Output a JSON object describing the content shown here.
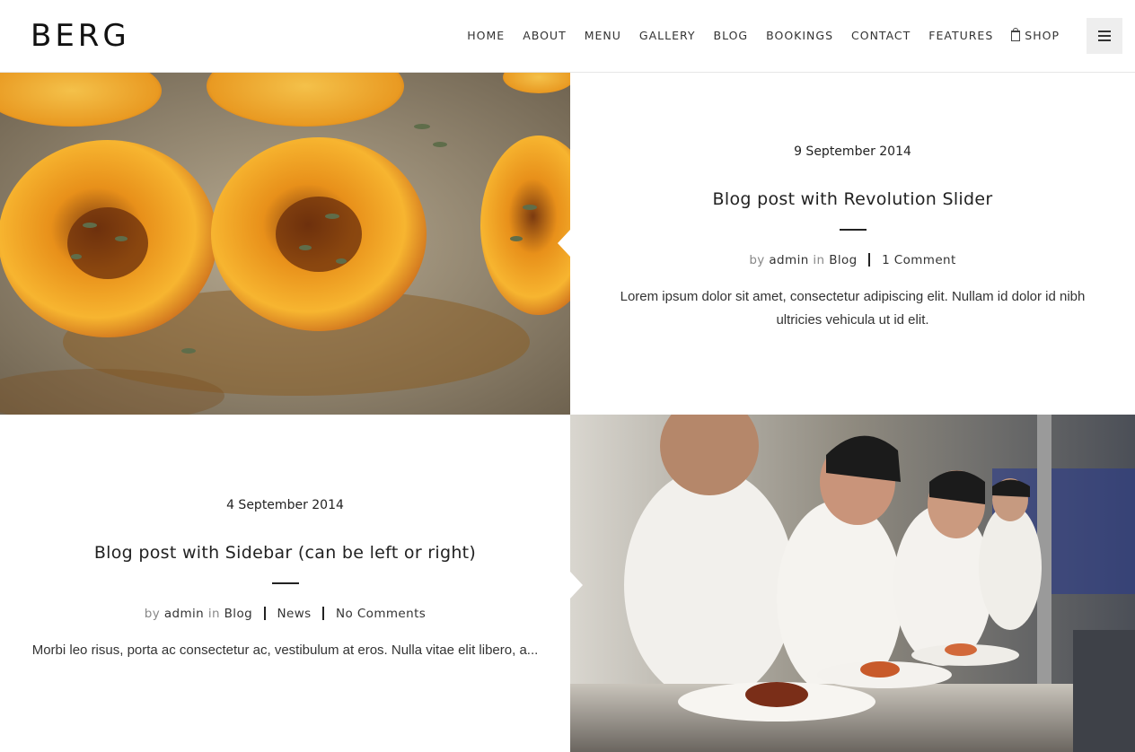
{
  "header": {
    "logo": "BERG",
    "nav": {
      "home": "HOME",
      "about": "ABOUT",
      "menu": "MENU",
      "gallery": "GALLERY",
      "blog": "BLOG",
      "bookings": "BOOKINGS",
      "contact": "CONTACT",
      "features": "FEATURES",
      "shop": "SHOP"
    },
    "shop_icon": "shopping-bag-icon",
    "menu_icon": "hamburger-menu-icon"
  },
  "posts": [
    {
      "date": "9 September 2014",
      "title": "Blog post with Revolution Slider",
      "by": "by",
      "author": "admin",
      "in": "in",
      "categories": [
        "Blog"
      ],
      "comments": "1 Comment",
      "excerpt": "Lorem ipsum dolor sit amet, consectetur adipiscing elit. Nullam id dolor id nibh ultricies vehicula ut id elit."
    },
    {
      "date": "4 September 2014",
      "title": "Blog post with Sidebar (can be left or right)",
      "by": "by",
      "author": "admin",
      "in": "in",
      "categories": [
        "Blog",
        "News"
      ],
      "comments": "No Comments",
      "excerpt": "Morbi leo risus, porta ac consectetur ac, vestibulum at eros. Nulla vitae elit libero, a..."
    }
  ],
  "colors": {
    "text": "#222222",
    "muted": "#888888",
    "border": "#e6e6e6",
    "menu_button_bg": "#eeeeee"
  }
}
